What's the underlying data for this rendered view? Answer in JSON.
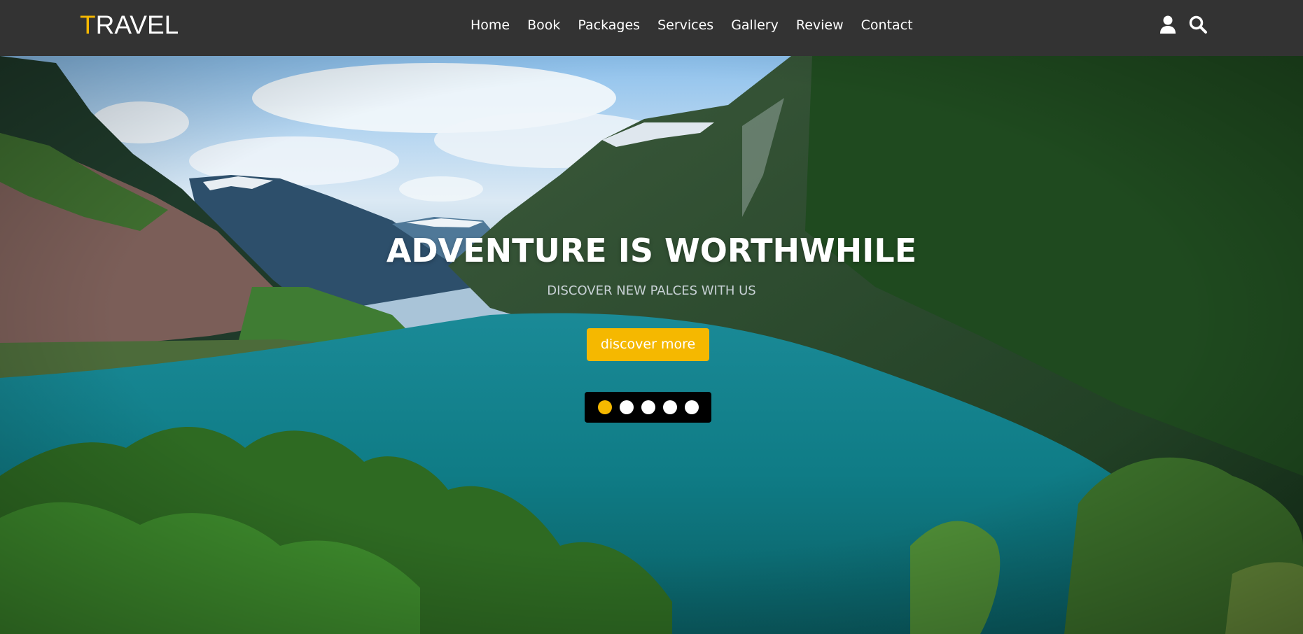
{
  "header": {
    "logo_first": "T",
    "logo_rest": "RAVEL",
    "nav": [
      "Home",
      "Book",
      "Packages",
      "Services",
      "Gallery",
      "Review",
      "Contact"
    ],
    "icons": [
      "user-icon",
      "search-icon"
    ]
  },
  "hero": {
    "title": "ADVENTURE IS WORTHWHILE",
    "subtitle": "DISCOVER NEW PALCES WITH US",
    "button_label": "discover more",
    "slides_count": 5,
    "active_slide": 1
  },
  "colors": {
    "accent": "#f5b800",
    "header_bg": "#333333",
    "text": "#ffffff"
  }
}
